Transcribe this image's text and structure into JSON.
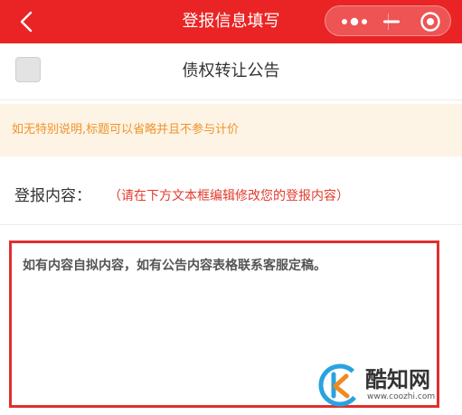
{
  "navbar": {
    "title": "登报信息填写",
    "back_icon": "chevron-left-icon",
    "capsule_icons": [
      "more-dots-icon",
      "minimize-icon",
      "record-icon"
    ],
    "color": "#ea2424"
  },
  "title_row": {
    "checked": false,
    "title": "债权转让公告"
  },
  "notice": {
    "text": "如无特别说明,标题可以省略并且不参与计价",
    "color": "#f0932c",
    "background": "#fdf4e5"
  },
  "content": {
    "label": "登报内容：",
    "hint": "（请在下方文本框编辑修改您的登报内容）",
    "hint_color": "#e23a2e"
  },
  "editor": {
    "text": "如有内容自拟内容，如有公告内容表格联系客服定稿。",
    "frame_color": "#e02f2f"
  },
  "watermark": {
    "name": "酷知网",
    "url": "www.coozhi.com"
  }
}
